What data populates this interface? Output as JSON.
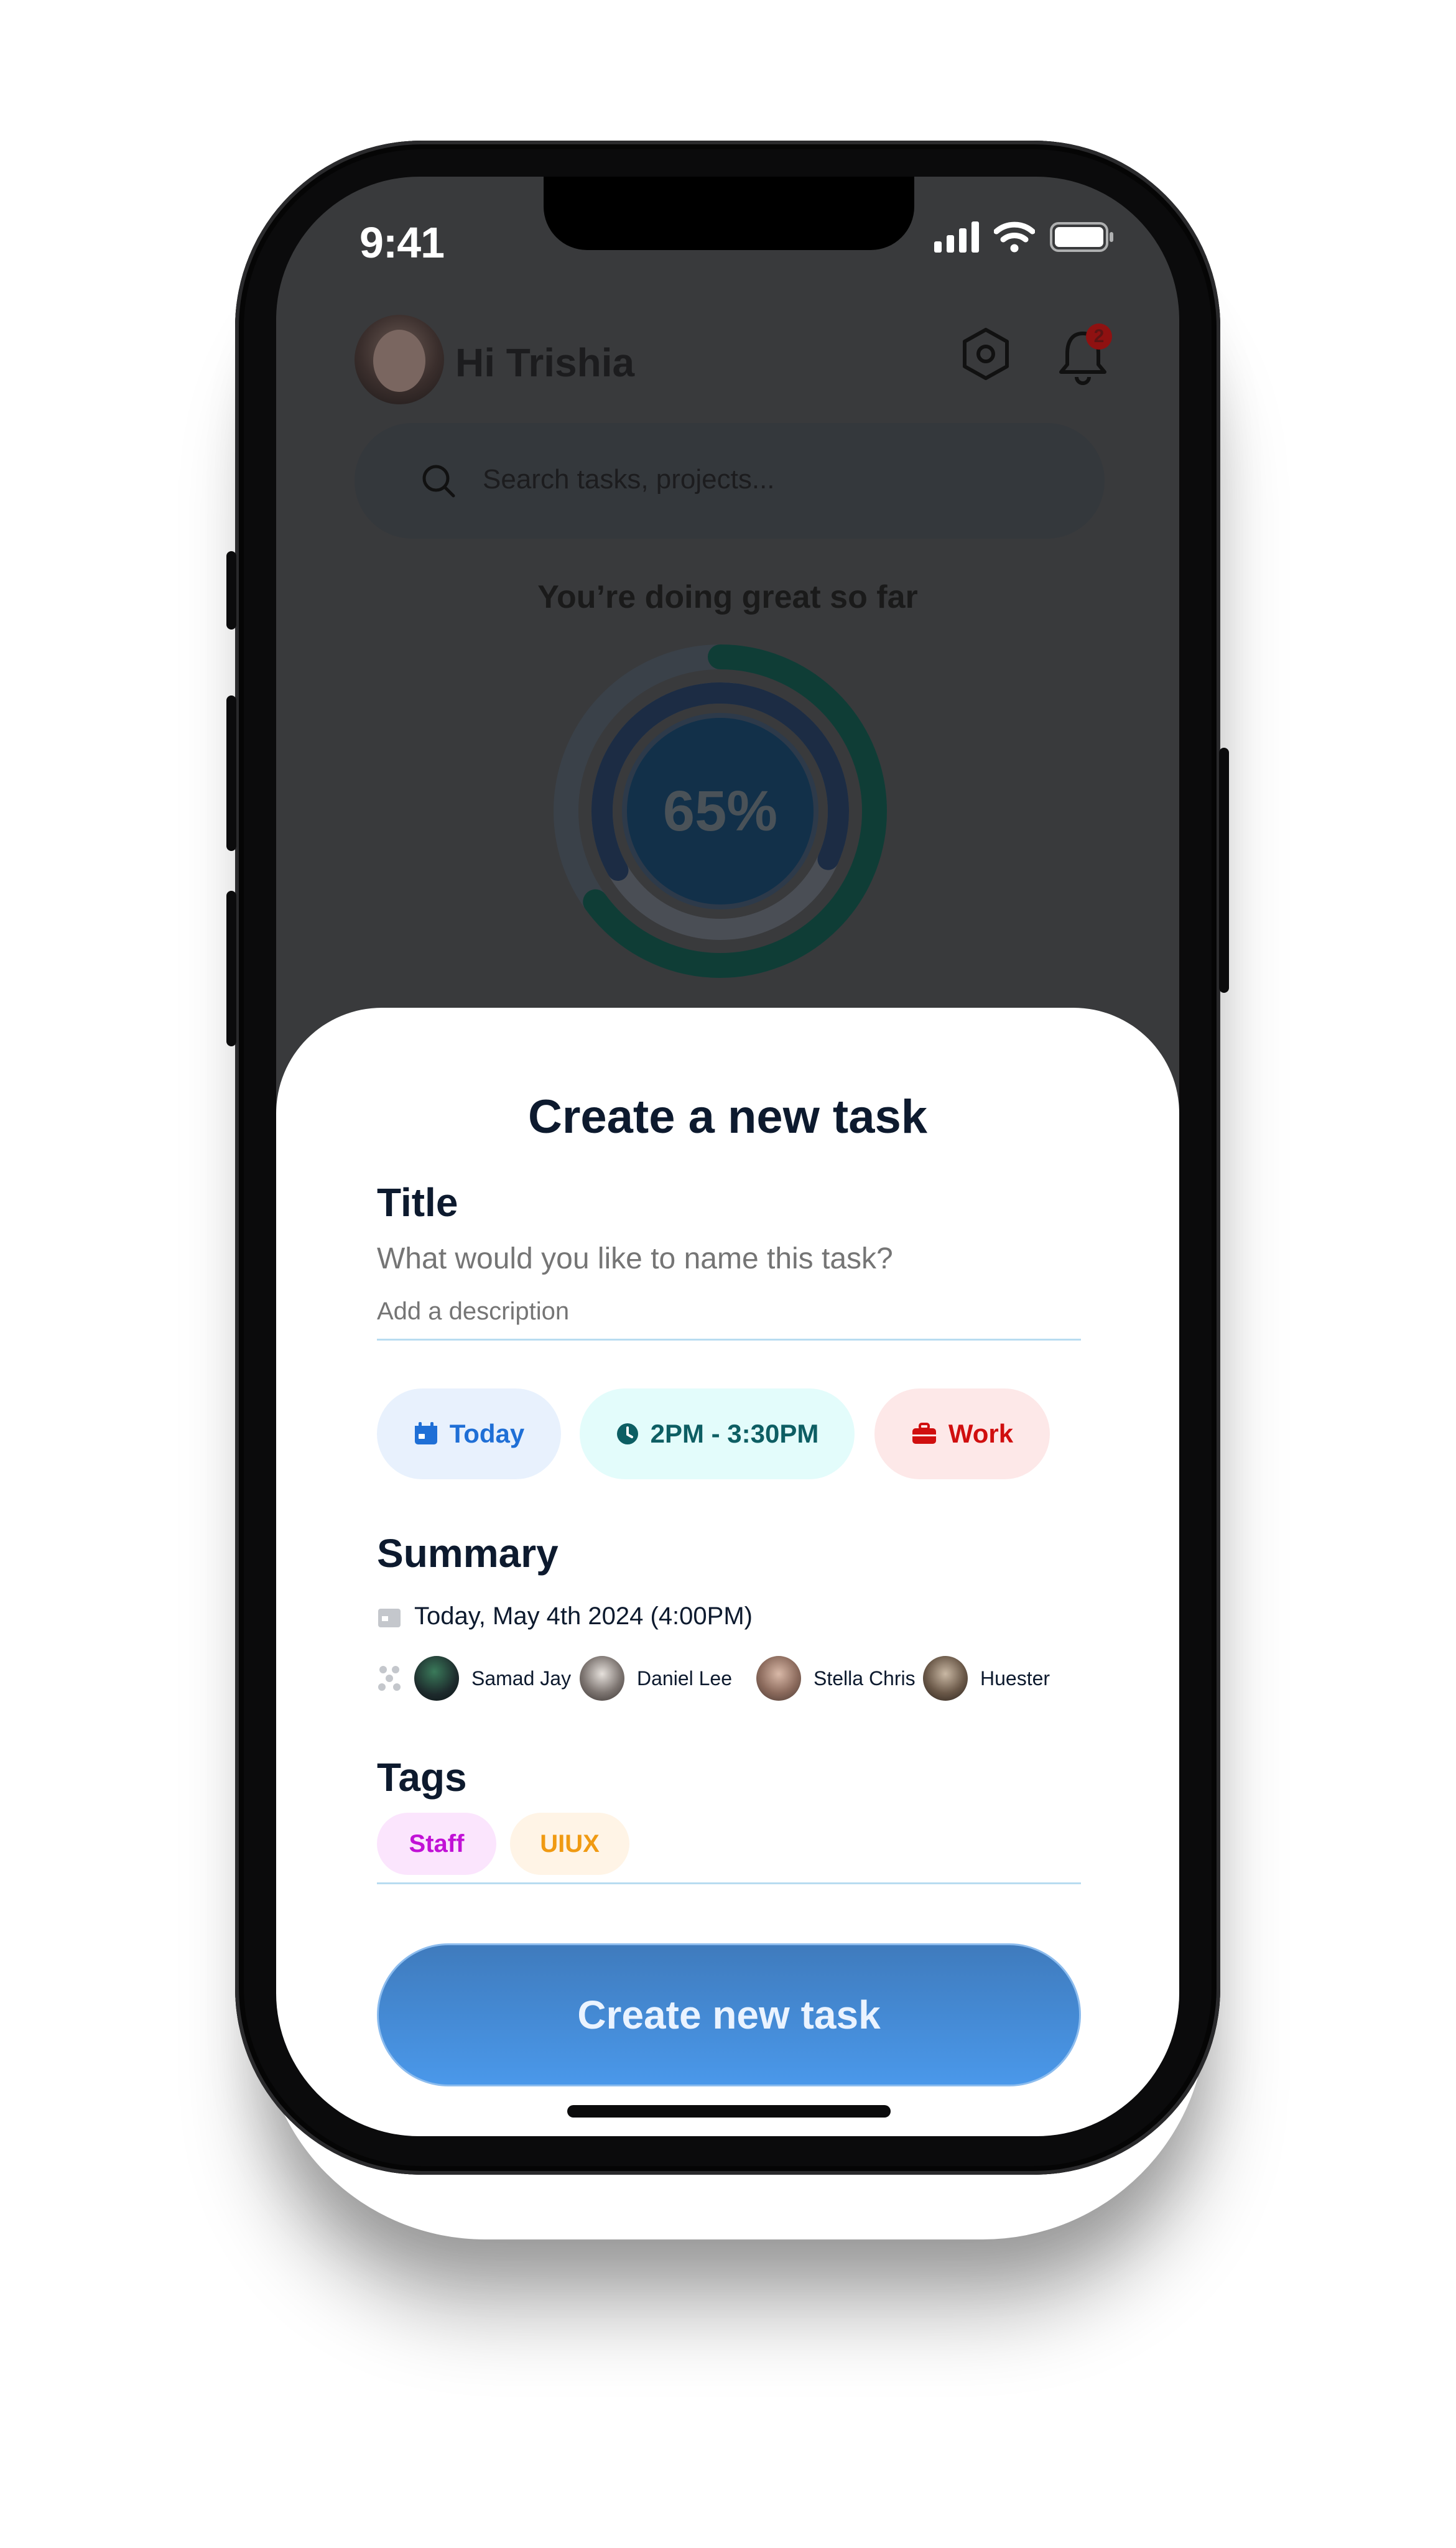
{
  "status_bar": {
    "time": "9:41"
  },
  "home": {
    "greeting": "Hi Trishia",
    "notification_count": "2",
    "search_placeholder": "Search tasks, projects...",
    "progress_title": "You’re doing great so far",
    "progress_percent_label": "65%",
    "progress_value": 0.65
  },
  "sheet": {
    "title": "Create a new task",
    "title_label": "Title",
    "title_placeholder": "What would you like to name this task?",
    "description_placeholder": "Add a description",
    "chips": {
      "today": "Today",
      "time": "2PM - 3:30PM",
      "work": "Work"
    },
    "summary_label": "Summary",
    "summary_date": "Today, May 4th 2024 (4:00PM)",
    "people": [
      "Samad Jay",
      "Daniel Lee",
      "Stella Chris",
      "Huester"
    ],
    "tags_label": "Tags",
    "tags": [
      "Staff",
      "UIUX"
    ],
    "create_button": "Create new task"
  },
  "colors": {
    "accent_blue": "#4a98ea",
    "today_chip": "#1f6fd6",
    "time_chip": "#0d5e63",
    "work_chip": "#d00f0f",
    "staff_tag": "#c111d6",
    "uiux_tag": "#f09a12"
  },
  "icons": {
    "settings": "hexagon-gear-icon",
    "notifications": "bell-icon",
    "search": "search-icon",
    "today_chip": "calendar-icon",
    "time_chip": "clock-icon",
    "work_chip": "briefcase-icon",
    "summary_date": "calendar-icon",
    "people": "people-icon"
  }
}
